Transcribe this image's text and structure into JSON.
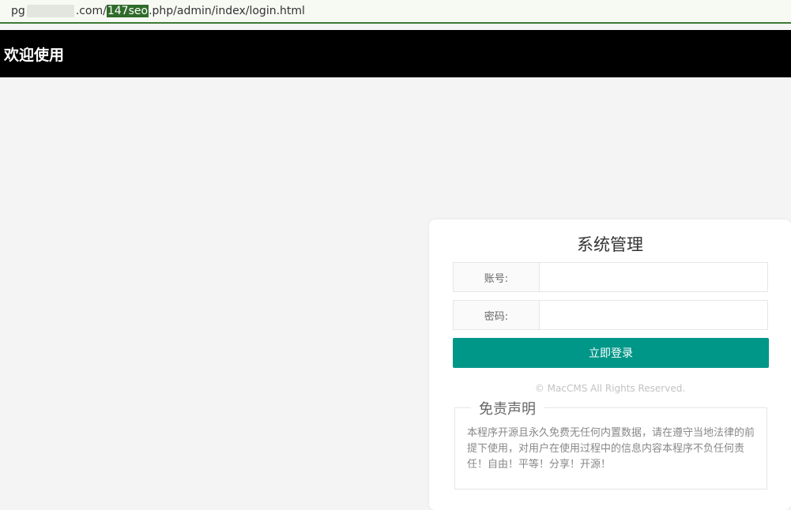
{
  "browser": {
    "url_prefix": "pg",
    "url_mid": ".com/",
    "url_highlight": "147seo",
    "url_suffix": ".php/admin/index/login.html"
  },
  "header": {
    "title": "欢迎使用"
  },
  "login": {
    "title": "系统管理",
    "username_label": "账号:",
    "username_value": "",
    "password_label": "密码:",
    "password_value": "",
    "submit_label": "立即登录",
    "copyright": "© MacCMS All Rights Reserved."
  },
  "disclaimer": {
    "title": "免责声明",
    "text": "本程序开源且永久免费无任何内置数据，请在遵守当地法律的前提下使用，对用户在使用过程中的信息内容本程序不负任何责任！自由！平等！分享！开源！"
  },
  "colors": {
    "accent": "#009688",
    "header_bg": "#000000",
    "page_bg": "#f4f4f4"
  }
}
